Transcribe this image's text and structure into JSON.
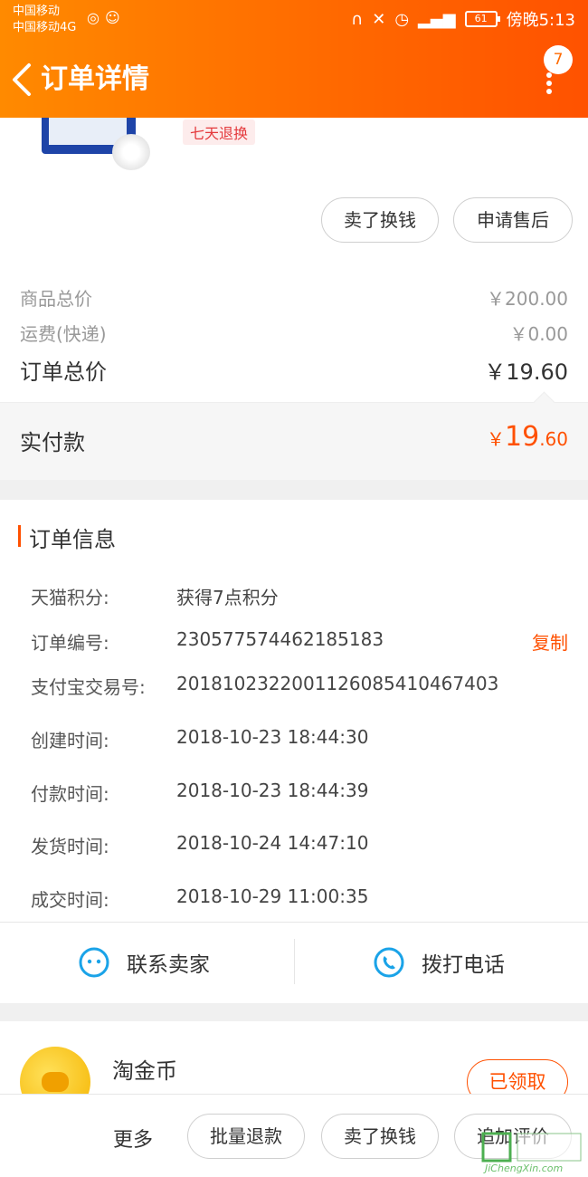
{
  "status_bar": {
    "carrier_1": "中国移动",
    "carrier_2": "中国移动4G",
    "battery": "61",
    "time": "傍晚5:13"
  },
  "header": {
    "title": "订单详情",
    "badge_count": "7"
  },
  "product": {
    "tag": "七天退换",
    "buttons": [
      "卖了换钱",
      "申请售后"
    ]
  },
  "prices": {
    "goods_total_label": "商品总价",
    "goods_total_value": "￥200.00",
    "shipping_label": "运费(快递)",
    "shipping_value": "￥0.00",
    "order_total_label": "订单总价",
    "order_total_value": "￥19.60",
    "paid_label": "实付款",
    "paid_symbol": "￥",
    "paid_int": "19",
    "paid_dec": ".60"
  },
  "order_info": {
    "title": "订单信息",
    "copy_label": "复制",
    "rows": [
      {
        "key": "天猫积分:",
        "value": "获得7点积分"
      },
      {
        "key": "订单编号:",
        "value": "2305775744621851​83"
      },
      {
        "key": "支付宝交易号:",
        "value": "2018102322001126085410467403"
      },
      {
        "key": "创建时间:",
        "value": "2018-10-23 18:44:30"
      },
      {
        "key": "付款时间:",
        "value": "2018-10-23 18:44:39"
      },
      {
        "key": "发货时间:",
        "value": "2018-10-24 14:47:10"
      },
      {
        "key": "成交时间:",
        "value": "2018-10-29 11:00:35"
      }
    ]
  },
  "contact": {
    "seller_label": "联系卖家",
    "phone_label": "拨打电话"
  },
  "taojinbi": {
    "title": "淘金币",
    "claimed_label": "已领取"
  },
  "bottom_bar": {
    "more_label": "更多",
    "buttons": [
      "批量退款",
      "卖了换钱",
      "追加评价"
    ]
  },
  "watermark": {
    "brand": "JiChengXin.com"
  },
  "colors": {
    "brand_orange": "#ff6a00",
    "price_orange": "#ff5000",
    "icon_blue": "#1aa3e8"
  }
}
